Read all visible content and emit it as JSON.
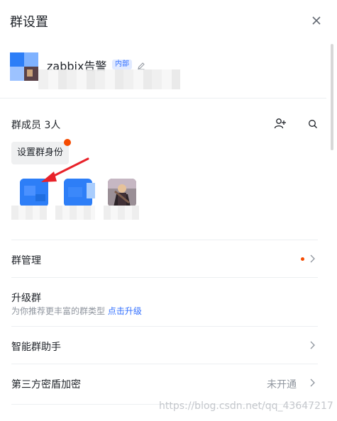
{
  "header": {
    "title": "群设置",
    "close_icon": "close-icon"
  },
  "group": {
    "name": "zabbix告警",
    "tag": "内部",
    "edit_icon": "pencil-icon",
    "avatar_colors": [
      "#2d7ef7",
      "#7fb2ff",
      "#5a4248"
    ]
  },
  "members": {
    "label": "群成员 3人",
    "add_icon": "add-user-icon",
    "search_icon": "search-icon",
    "role_button": "设置群身份",
    "badge_color": "#f54a00",
    "items": [
      {
        "icon": "member-avatar-blue"
      },
      {
        "icon": "member-avatar-blue"
      },
      {
        "icon": "member-avatar-photo"
      }
    ]
  },
  "settings": {
    "manage": {
      "label": "群管理"
    },
    "upgrade": {
      "label": "升级群",
      "desc": "为你推荐更丰富的群类型",
      "link": "点击升级"
    },
    "assistant": {
      "label": "智能群助手"
    },
    "encryption": {
      "label": "第三方密盾加密",
      "value": "未开通"
    }
  },
  "watermark": "https://blog.csdn.net/qq_43647217",
  "colors": {
    "accent": "#3370ff",
    "text": "#1f2329",
    "muted": "#8f959e",
    "annotation": "#e8222a"
  }
}
